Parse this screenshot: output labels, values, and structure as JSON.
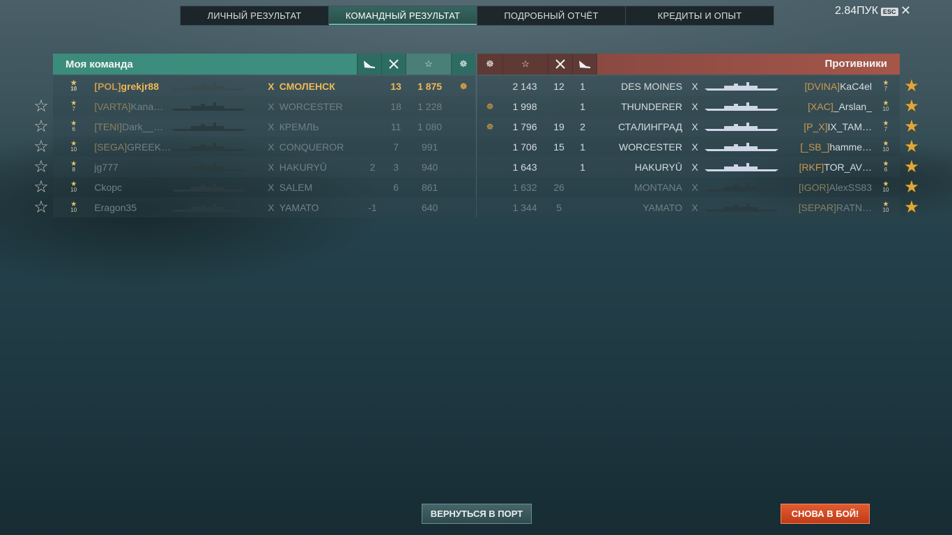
{
  "tabs": [
    {
      "label": "ЛИЧНЫЙ РЕЗУЛЬТАТ",
      "active": false
    },
    {
      "label": "КОМАНДНЫЙ РЕЗУЛЬТАТ",
      "active": true
    },
    {
      "label": "ПОДРОБНЫЙ ОТЧЁТ",
      "active": false
    },
    {
      "label": "КРЕДИТЫ И ОПЫТ",
      "active": false
    }
  ],
  "topbar": {
    "fps": "2.84ПУК",
    "esc": "ESC",
    "close": "✕"
  },
  "my_team": {
    "title": "Моя команда",
    "header_icons": [
      "plane-icon",
      "crossed-swords-icon",
      "star-icon",
      "achievement-icon"
    ],
    "rows": [
      {
        "level": "10",
        "clan": "[POL]",
        "player": "grekjr88",
        "tier": "X",
        "ship": "СМОЛЕНСК",
        "planes": "",
        "kills": "13",
        "exp": "1 875",
        "badge": "☸",
        "status": "me",
        "side_star": "none"
      },
      {
        "level": "7",
        "clan": "[VARTA]",
        "player": "Kana…",
        "tier": "X",
        "ship": "WORCESTER",
        "planes": "",
        "kills": "18",
        "exp": "1 228",
        "badge": "",
        "status": "dead",
        "side_star": "empty"
      },
      {
        "level": "6",
        "clan": "[TENI]",
        "player": "Dark__…",
        "tier": "X",
        "ship": "КРЕМЛЬ",
        "planes": "",
        "kills": "11",
        "exp": "1 080",
        "badge": "",
        "status": "dead",
        "side_star": "empty"
      },
      {
        "level": "10",
        "clan": "[SEGA]",
        "player": "GREEK…",
        "tier": "X",
        "ship": "CONQUEROR",
        "planes": "",
        "kills": "7",
        "exp": "991",
        "badge": "",
        "status": "dead",
        "side_star": "empty"
      },
      {
        "level": "8",
        "clan": "",
        "player": "jg777",
        "tier": "X",
        "ship": "HAKURYŪ",
        "planes": "2",
        "kills": "3",
        "exp": "940",
        "badge": "",
        "status": "dead",
        "side_star": "empty"
      },
      {
        "level": "10",
        "clan": "",
        "player": "Ckopc",
        "tier": "X",
        "ship": "SALEM",
        "planes": "",
        "kills": "6",
        "exp": "861",
        "badge": "",
        "status": "dead",
        "side_star": "empty"
      },
      {
        "level": "10",
        "clan": "",
        "player": "Eragon35",
        "tier": "X",
        "ship": "YAMATO",
        "planes": "-1",
        "kills": "",
        "exp": "640",
        "badge": "",
        "status": "dead",
        "side_star": "empty"
      }
    ]
  },
  "enemy_team": {
    "title": "Противники",
    "rows": [
      {
        "badge": "",
        "exp": "2 143",
        "kills": "12",
        "planes": "1",
        "ship": "DES MOINES",
        "tier": "X",
        "clan": "[DVINA]",
        "player": "KaC4el",
        "level": "7",
        "status": "alive",
        "side_star": "full"
      },
      {
        "badge": "☸",
        "exp": "1 998",
        "kills": "",
        "planes": "1",
        "ship": "THUNDERER",
        "tier": "X",
        "clan": "[XAC]",
        "player": "_Arslan_",
        "level": "10",
        "status": "alive",
        "side_star": "full"
      },
      {
        "badge": "☸",
        "exp": "1 796",
        "kills": "19",
        "planes": "2",
        "ship": "СТАЛИНГРАД",
        "tier": "X",
        "clan": "[P_X]",
        "player": "IX_TAM…",
        "level": "7",
        "status": "alive",
        "side_star": "full"
      },
      {
        "badge": "",
        "exp": "1 706",
        "kills": "15",
        "planes": "1",
        "ship": "WORCESTER",
        "tier": "X",
        "clan": "[_SB_]",
        "player": "hamme…",
        "level": "10",
        "status": "alive",
        "side_star": "full"
      },
      {
        "badge": "",
        "exp": "1 643",
        "kills": "",
        "planes": "1",
        "ship": "HAKURYŪ",
        "tier": "X",
        "clan": "[RKF]",
        "player": "TOR_AV…",
        "level": "6",
        "status": "alive",
        "side_star": "full"
      },
      {
        "badge": "",
        "exp": "1 632",
        "kills": "26",
        "planes": "",
        "ship": "MONTANA",
        "tier": "X",
        "clan": "[IGOR]",
        "player": "AlexSS83",
        "level": "10",
        "status": "dead",
        "side_star": "full"
      },
      {
        "badge": "",
        "exp": "1 344",
        "kills": "5",
        "planes": "",
        "ship": "YAMATO",
        "tier": "X",
        "clan": "[SEPAR]",
        "player": "RATN…",
        "level": "10",
        "status": "dead",
        "side_star": "full"
      }
    ]
  },
  "buttons": {
    "port": "ВЕРНУТЬСЯ В ПОРТ",
    "battle": "СНОВА В БОЙ!"
  },
  "colors": {
    "my_team": "#3e8f80",
    "enemy": "#9b5245",
    "accent_gold": "#e0a83c",
    "battle_button": "#d24a23"
  }
}
